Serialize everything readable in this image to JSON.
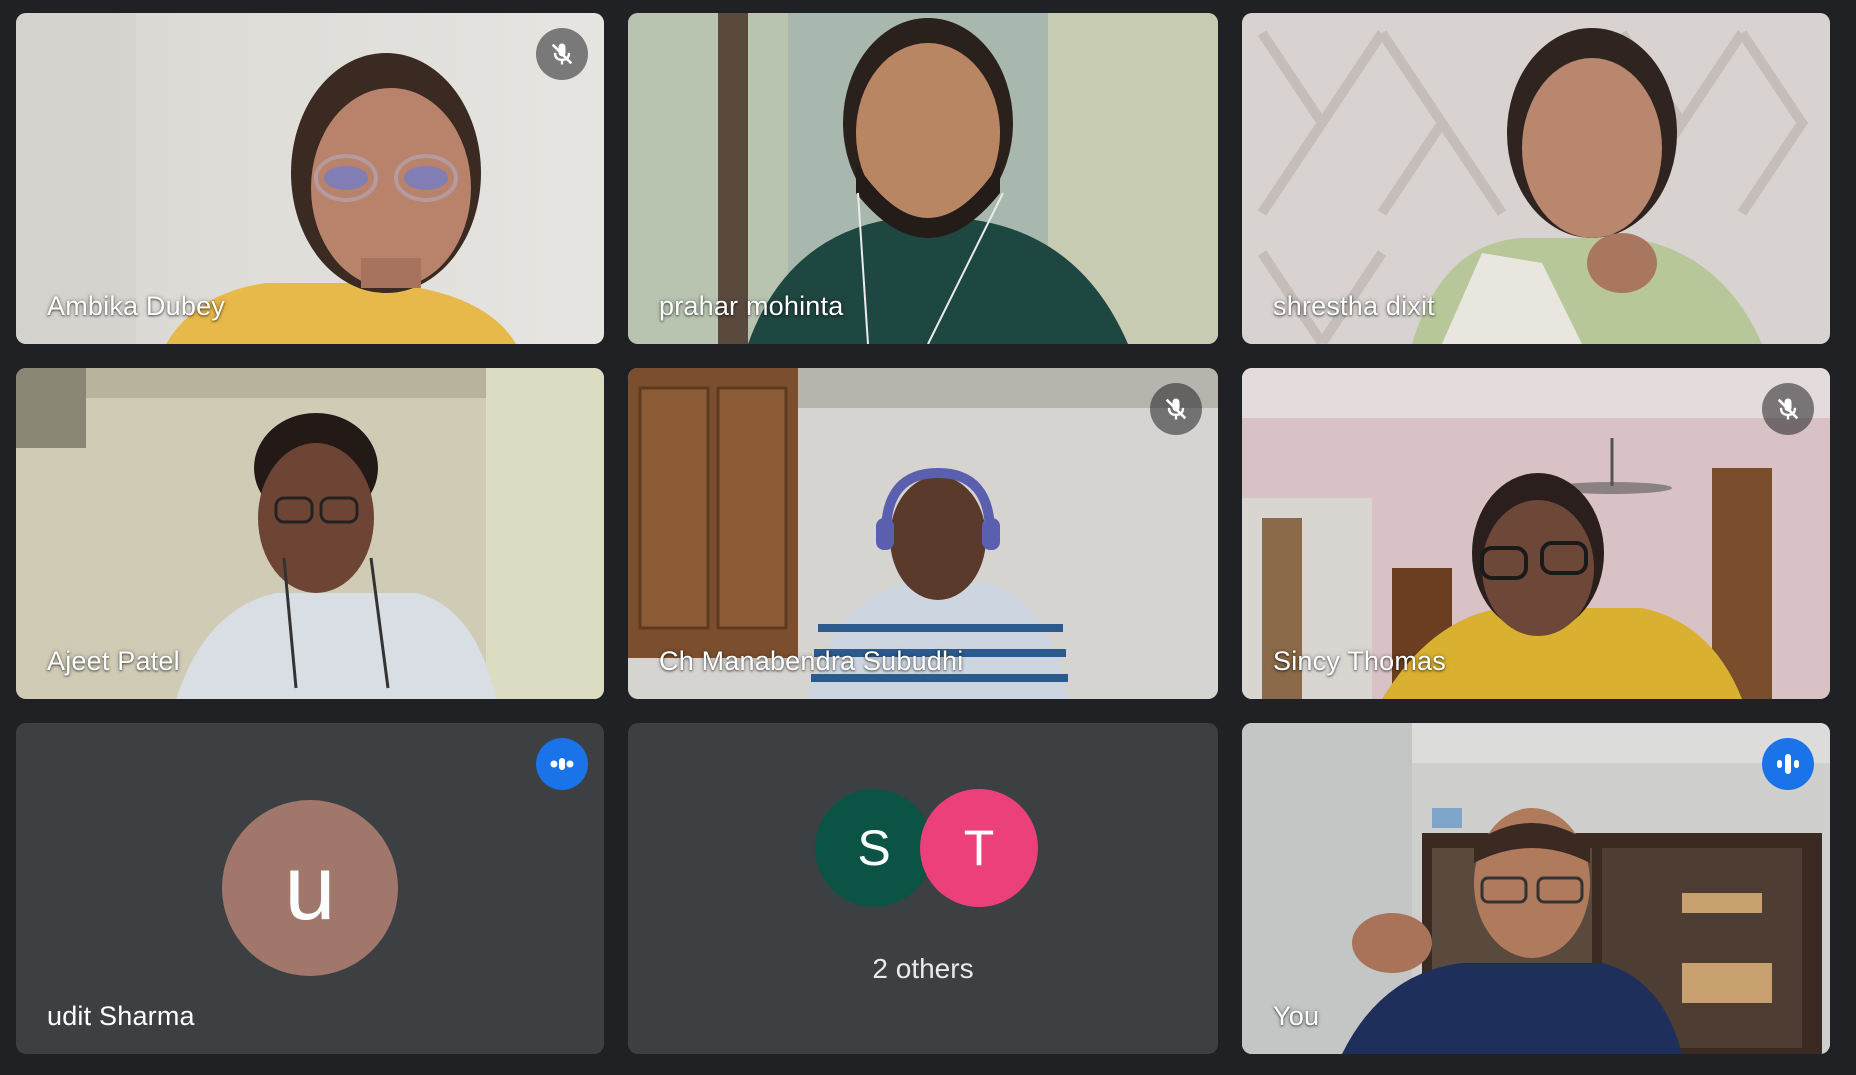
{
  "participants": [
    {
      "name": "Ambika Dubey",
      "muted": true
    },
    {
      "name": "prahar mohinta",
      "muted": false
    },
    {
      "name": "shrestha dixit",
      "muted": false
    },
    {
      "name": "Ajeet Patel",
      "muted": false
    },
    {
      "name": "Ch Manabendra Subudhi",
      "muted": true
    },
    {
      "name": "Sincy Thomas",
      "muted": true
    },
    {
      "name": "udit Sharma",
      "avatar_letter": "u",
      "avatar_color": "#a1776b",
      "status": "speaking-indicator"
    },
    {
      "others_count_label": "2 others",
      "avatars": [
        {
          "letter": "S",
          "color": "#0b5345"
        },
        {
          "letter": "T",
          "color": "#ec407a"
        }
      ]
    },
    {
      "name": "You",
      "status": "speaking",
      "highlight_color": "#8ab4f8"
    }
  ],
  "icons": {
    "muted": "mic-off-icon",
    "speaking": "audio-level-icon"
  },
  "colors": {
    "background": "#202124",
    "tile": "#3c4043",
    "active_speaker_border": "#8ab4f8",
    "speak_indicator": "#1a73e8"
  }
}
